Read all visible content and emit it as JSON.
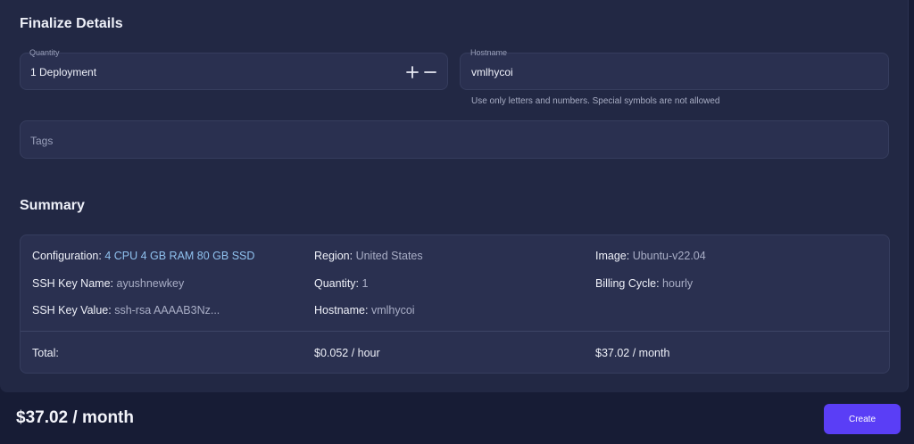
{
  "finalize": {
    "title": "Finalize Details",
    "quantity": {
      "label": "Quantity",
      "value": "1 Deployment",
      "plus_symbol": "+",
      "minus_symbol": "−"
    },
    "hostname": {
      "label": "Hostname",
      "value": "vmlhycoi",
      "helper": "Use only letters and numbers. Special symbols are not allowed"
    },
    "tags": {
      "placeholder": "Tags"
    }
  },
  "summary": {
    "title": "Summary",
    "configuration": {
      "key": "Configuration:",
      "value": "4 CPU 4 GB RAM 80 GB SSD"
    },
    "region": {
      "key": "Region:",
      "value": "United States"
    },
    "image": {
      "key": "Image:",
      "value": "Ubuntu-v22.04"
    },
    "ssh_key_name": {
      "key": "SSH Key Name:",
      "value": "ayushnewkey"
    },
    "quantity": {
      "key": "Quantity:",
      "value": "1"
    },
    "billing_cycle": {
      "key": "Billing Cycle:",
      "value": "hourly"
    },
    "ssh_key_value": {
      "key": "SSH Key Value:",
      "value": "ssh-rsa AAAAB3Nz..."
    },
    "hostname": {
      "key": "Hostname:",
      "value": "vmlhycoi"
    },
    "total": {
      "label": "Total:",
      "hourly": "$0.052 / hour",
      "monthly": "$37.02 / month"
    }
  },
  "footer": {
    "price": "$37.02 / month",
    "create_label": "Create"
  },
  "colors": {
    "background": "#171c35",
    "panel": "#222844",
    "field": "#2a3050",
    "accent_value": "#8fc1ee",
    "primary_button": "#5a3ef6"
  }
}
